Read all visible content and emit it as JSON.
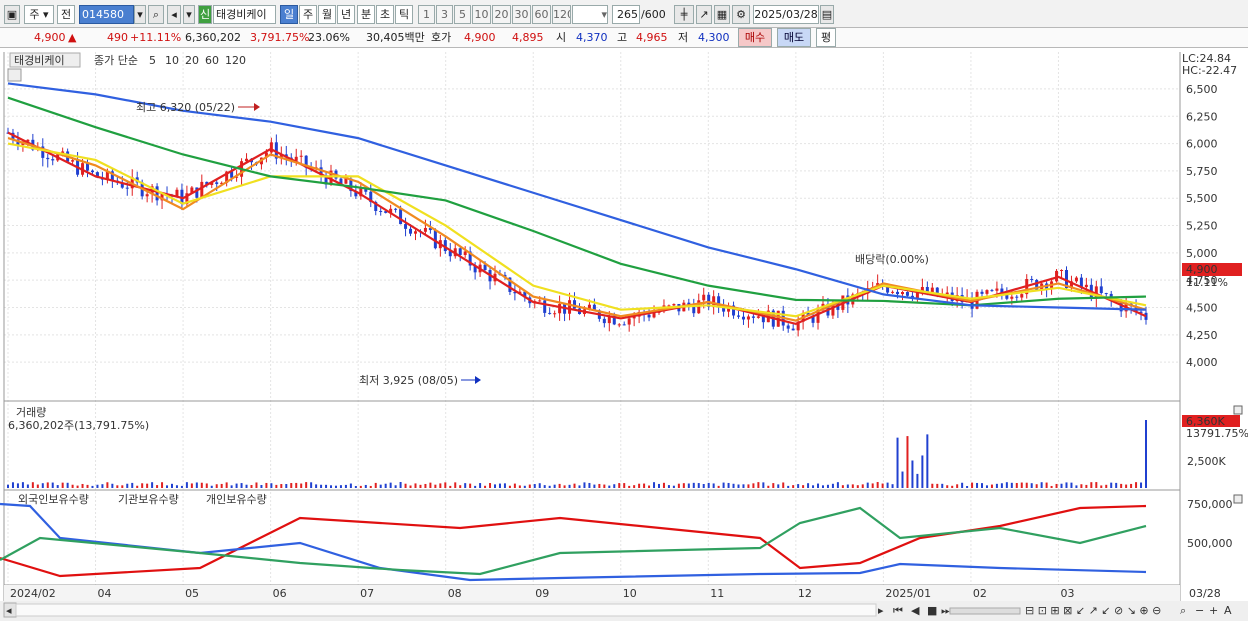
{
  "toolbar": {
    "market": "주",
    "prev": "전",
    "code": "014580",
    "stock_name": "태경비케이",
    "shin": "신",
    "periods": [
      "일",
      "주",
      "월",
      "년",
      "분",
      "초",
      "틱"
    ],
    "active_period": "일",
    "intervals": [
      "1",
      "3",
      "5",
      "10",
      "20",
      "30",
      "60",
      "120"
    ],
    "count": "265",
    "count_total": "/600",
    "date": "2025/03/28",
    "icons": [
      "window-icon",
      "dropdown-icon",
      "search-icon",
      "speaker-icon",
      "candle-icon",
      "chart-tool-icon",
      "table-icon",
      "gear-icon",
      "calendar-icon"
    ]
  },
  "quote": {
    "price": "4,900",
    "up_mark": "▲",
    "change": "490",
    "change_pct": "+11.11%",
    "volume": "6,360,202",
    "volume_pct": "3,791.75%",
    "turnover": "23.06%",
    "amount": "30,405백만",
    "hoga_label": "호가",
    "ask": "4,900",
    "bid": "4,895",
    "open_label": "시",
    "open": "4,370",
    "high_label": "고",
    "high": "4,965",
    "low_label": "저",
    "low": "4,300",
    "buy_btn": "매수",
    "sell_btn": "매도",
    "eval_btn": "평"
  },
  "price_panel": {
    "title": "태경비케이",
    "ma_label": "종가 단순",
    "ma_periods": [
      "5",
      "10",
      "20",
      "60",
      "120"
    ],
    "ma_colors": [
      "#e02020",
      "#f08a20",
      "#f0e020",
      "#20a040",
      "#3060e0"
    ],
    "lc": "LC:24.84",
    "hc": "HC:-22.47",
    "y_ticks": [
      "6,500",
      "6,250",
      "6,000",
      "5,750",
      "5,500",
      "5,250",
      "5,000",
      "4,750",
      "4,500",
      "4,250",
      "4,000"
    ],
    "high_note": "최고 6,320 (05/22)",
    "low_note": "최저 3,925 (08/05)",
    "ex_note": "배당락(0.00%)",
    "cur_price": "4,900",
    "cur_pct": "11.11%"
  },
  "volume_panel": {
    "title": "거래량",
    "value": "6,360,202주(13,791.75%)",
    "y_tick": "2,500K",
    "cur": "6,360K",
    "cur_pct": "13791.75%"
  },
  "holding_panel": {
    "labels": [
      "외국인보유수량",
      "기관보유수량",
      "개인보유수량"
    ],
    "colors": [
      "#e01010",
      "#3060e0",
      "#30a060"
    ],
    "y_ticks": [
      "750,000",
      "500,000"
    ]
  },
  "x_axis": [
    "2024/02",
    "04",
    "05",
    "06",
    "07",
    "08",
    "09",
    "10",
    "11",
    "12",
    "2025/01",
    "02",
    "03",
    "03/28"
  ],
  "chart_data": {
    "type": "line",
    "title": "태경비케이",
    "ylim": [
      3800,
      6600
    ],
    "x": [
      "2024/02",
      "04",
      "05",
      "06",
      "07",
      "08",
      "09",
      "10",
      "11",
      "12",
      "2025/01",
      "02",
      "03",
      "03/28"
    ],
    "series": [
      {
        "name": "5",
        "values": [
          6100,
          5700,
          5500,
          5950,
          5550,
          5050,
          4550,
          4400,
          4550,
          4350,
          4700,
          4550,
          4780,
          4420
        ]
      },
      {
        "name": "10",
        "values": [
          6050,
          5800,
          5400,
          5900,
          5650,
          5150,
          4600,
          4420,
          4550,
          4380,
          4720,
          4560,
          4720,
          4480
        ]
      },
      {
        "name": "20",
        "values": [
          6000,
          5850,
          5450,
          5700,
          5700,
          5250,
          4700,
          4480,
          4520,
          4420,
          4700,
          4580,
          4680,
          4520
        ]
      },
      {
        "name": "60",
        "values": [
          6420,
          6150,
          5900,
          5700,
          5600,
          5480,
          5200,
          4900,
          4700,
          4570,
          4560,
          4520,
          4580,
          4600
        ]
      },
      {
        "name": "120",
        "values": [
          6550,
          6450,
          6300,
          6200,
          6050,
          5800,
          5550,
          5300,
          5050,
          4850,
          4620,
          4520,
          4500,
          4480
        ]
      }
    ]
  }
}
